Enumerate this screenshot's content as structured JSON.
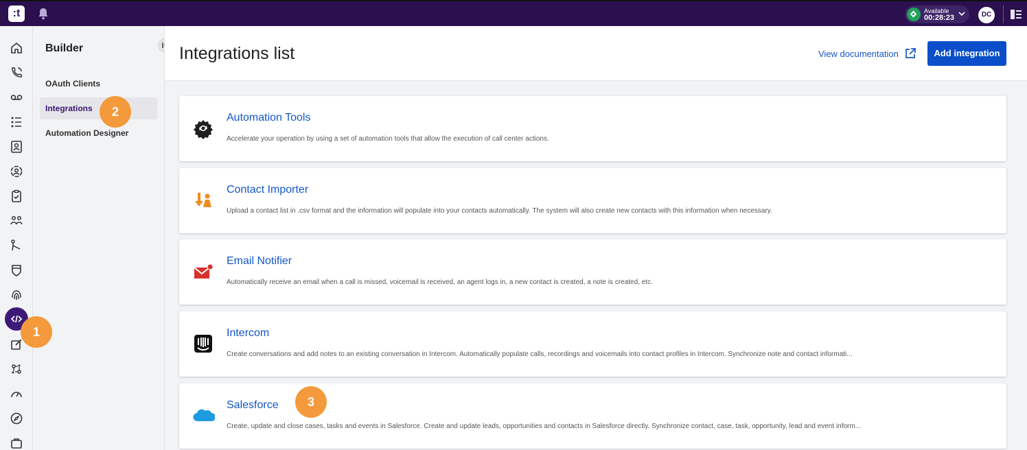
{
  "topbar": {
    "logo": ":t",
    "status_label": "Available",
    "status_time": "00:28:23",
    "avatar_initials": "DC"
  },
  "sidebar": {
    "title": "Builder",
    "items": [
      {
        "label": "OAuth Clients"
      },
      {
        "label": "Integrations"
      },
      {
        "label": "Automation Designer"
      }
    ]
  },
  "header": {
    "title": "Integrations list",
    "doc_link": "View documentation",
    "add_button": "Add integration"
  },
  "integrations": [
    {
      "name": "Automation Tools",
      "description": "Accelerate your operation by using a set of automation tools that allow the execution of call center actions.",
      "icon": "gear-automation-icon"
    },
    {
      "name": "Contact Importer",
      "description": "Upload a contact list in .csv format and the information will populate into your contacts automatically. The system will also create new contacts with this information when necessary.",
      "icon": "contact-importer-icon"
    },
    {
      "name": "Email Notifier",
      "description": "Automatically receive an email when a call is missed, voicemail is received, an agent logs in, a new contact is created, a note is created, etc.",
      "icon": "email-notifier-icon"
    },
    {
      "name": "Intercom",
      "description": "Create conversations and add notes to an existing conversation in Intercom. Automatically populate calls, recordings and voicemails into contact profiles in Intercom. Synchronize note and contact informati...",
      "icon": "intercom-icon"
    },
    {
      "name": "Salesforce",
      "description": "Create, update and close cases, tasks and events in Salesforce. Create and update leads, opportunities and contacts in Salesforce directly. Synchronize contact, case, task, opportunity, lead and event inform...",
      "icon": "salesforce-icon"
    }
  ],
  "callouts": [
    "1",
    "2",
    "3"
  ],
  "colors": {
    "topbar": "#2b0f4e",
    "accent": "#1456c8",
    "button": "#0a4fc9",
    "callout": "#f49a3c"
  }
}
